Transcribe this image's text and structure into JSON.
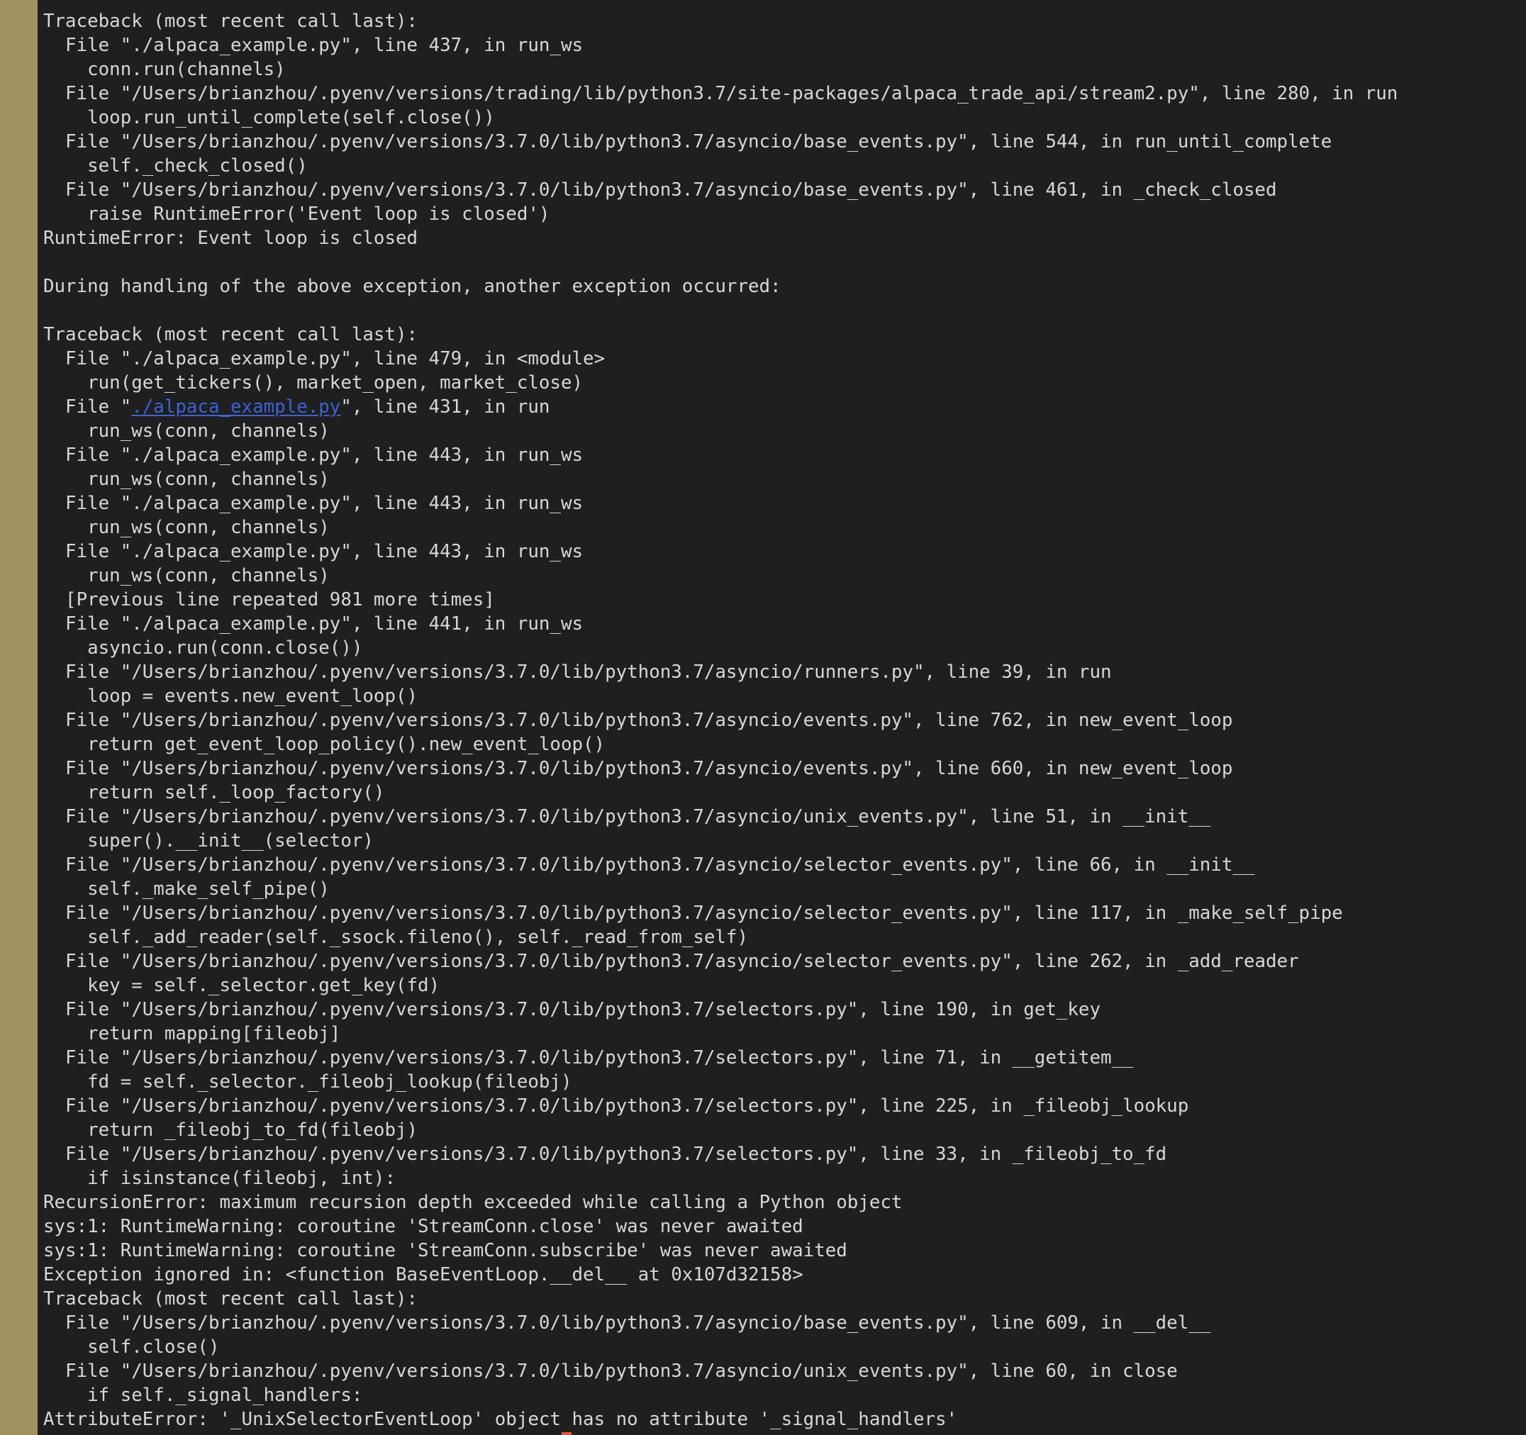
{
  "terminal": {
    "lines": {
      "l0": "Traceback (most recent call last):",
      "l1": "  File \"./alpaca_example.py\", line 437, in run_ws",
      "l2": "    conn.run(channels)",
      "l3": "  File \"/Users/brianzhou/.pyenv/versions/trading/lib/python3.7/site-packages/alpaca_trade_api/stream2.py\", line 280, in run",
      "l4": "    loop.run_until_complete(self.close())",
      "l5": "  File \"/Users/brianzhou/.pyenv/versions/3.7.0/lib/python3.7/asyncio/base_events.py\", line 544, in run_until_complete",
      "l6": "    self._check_closed()",
      "l7": "  File \"/Users/brianzhou/.pyenv/versions/3.7.0/lib/python3.7/asyncio/base_events.py\", line 461, in _check_closed",
      "l8": "    raise RuntimeError('Event loop is closed')",
      "l9": "RuntimeError: Event loop is closed",
      "l10": "",
      "l11": "During handling of the above exception, another exception occurred:",
      "l12": "",
      "l13": "Traceback (most recent call last):",
      "l14": "  File \"./alpaca_example.py\", line 479, in <module>",
      "l15": "    run(get_tickers(), market_open, market_close)",
      "l16_before": "  File \"",
      "l16_link": "./alpaca_example.py",
      "l16_after": "\", line 431, in run",
      "l17": "    run_ws(conn, channels)",
      "l18": "  File \"./alpaca_example.py\", line 443, in run_ws",
      "l19": "    run_ws(conn, channels)",
      "l20": "  File \"./alpaca_example.py\", line 443, in run_ws",
      "l21": "    run_ws(conn, channels)",
      "l22": "  File \"./alpaca_example.py\", line 443, in run_ws",
      "l23": "    run_ws(conn, channels)",
      "l24": "  [Previous line repeated 981 more times]",
      "l25": "  File \"./alpaca_example.py\", line 441, in run_ws",
      "l26": "    asyncio.run(conn.close())",
      "l27": "  File \"/Users/brianzhou/.pyenv/versions/3.7.0/lib/python3.7/asyncio/runners.py\", line 39, in run",
      "l28": "    loop = events.new_event_loop()",
      "l29": "  File \"/Users/brianzhou/.pyenv/versions/3.7.0/lib/python3.7/asyncio/events.py\", line 762, in new_event_loop",
      "l30": "    return get_event_loop_policy().new_event_loop()",
      "l31": "  File \"/Users/brianzhou/.pyenv/versions/3.7.0/lib/python3.7/asyncio/events.py\", line 660, in new_event_loop",
      "l32": "    return self._loop_factory()",
      "l33": "  File \"/Users/brianzhou/.pyenv/versions/3.7.0/lib/python3.7/asyncio/unix_events.py\", line 51, in __init__",
      "l34": "    super().__init__(selector)",
      "l35": "  File \"/Users/brianzhou/.pyenv/versions/3.7.0/lib/python3.7/asyncio/selector_events.py\", line 66, in __init__",
      "l36": "    self._make_self_pipe()",
      "l37": "  File \"/Users/brianzhou/.pyenv/versions/3.7.0/lib/python3.7/asyncio/selector_events.py\", line 117, in _make_self_pipe",
      "l38": "    self._add_reader(self._ssock.fileno(), self._read_from_self)",
      "l39": "  File \"/Users/brianzhou/.pyenv/versions/3.7.0/lib/python3.7/asyncio/selector_events.py\", line 262, in _add_reader",
      "l40": "    key = self._selector.get_key(fd)",
      "l41": "  File \"/Users/brianzhou/.pyenv/versions/3.7.0/lib/python3.7/selectors.py\", line 190, in get_key",
      "l42": "    return mapping[fileobj]",
      "l43": "  File \"/Users/brianzhou/.pyenv/versions/3.7.0/lib/python3.7/selectors.py\", line 71, in __getitem__",
      "l44": "    fd = self._selector._fileobj_lookup(fileobj)",
      "l45": "  File \"/Users/brianzhou/.pyenv/versions/3.7.0/lib/python3.7/selectors.py\", line 225, in _fileobj_lookup",
      "l46": "    return _fileobj_to_fd(fileobj)",
      "l47": "  File \"/Users/brianzhou/.pyenv/versions/3.7.0/lib/python3.7/selectors.py\", line 33, in _fileobj_to_fd",
      "l48": "    if isinstance(fileobj, int):",
      "l49": "RecursionError: maximum recursion depth exceeded while calling a Python object",
      "l50": "sys:1: RuntimeWarning: coroutine 'StreamConn.close' was never awaited",
      "l51": "sys:1: RuntimeWarning: coroutine 'StreamConn.subscribe' was never awaited",
      "l52": "Exception ignored in: <function BaseEventLoop.__del__ at 0x107d32158>",
      "l53": "Traceback (most recent call last):",
      "l54": "  File \"/Users/brianzhou/.pyenv/versions/3.7.0/lib/python3.7/asyncio/base_events.py\", line 609, in __del__",
      "l55": "    self.close()",
      "l56": "  File \"/Users/brianzhou/.pyenv/versions/3.7.0/lib/python3.7/asyncio/unix_events.py\", line 60, in close",
      "l57": "    if self._signal_handlers:",
      "l58": "AttributeError: '_UnixSelectorEventLoop' object has no attribute '_signal_handlers'"
    }
  },
  "colors": {
    "terminal_background": "#1f1f1f",
    "terminal_text": "#d7d7d7",
    "link": "#3b63d8",
    "cursor": "#e05d2f"
  }
}
